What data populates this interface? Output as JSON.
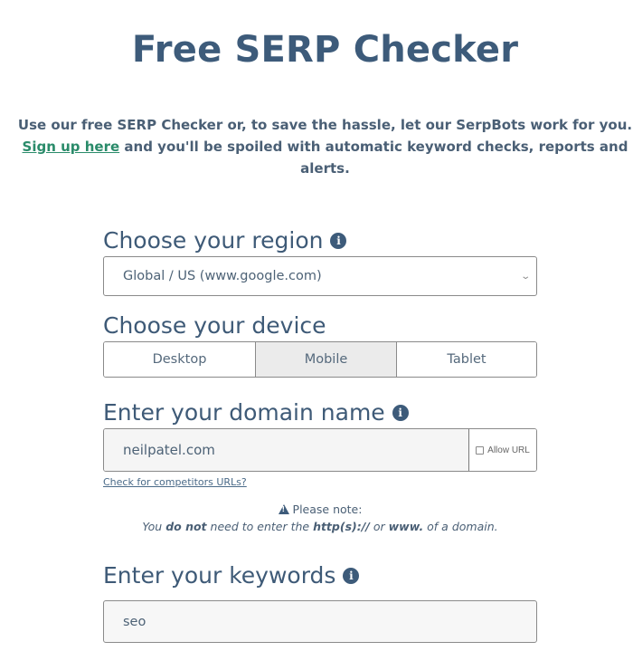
{
  "page": {
    "title": "Free SERP Checker",
    "intro_line1": "Use our free SERP Checker or, to save the hassle, let our SerpBots work for you.",
    "signup_link": "Sign up here",
    "intro_line2_rest": " and you'll be spoiled with automatic keyword checks, reports and alerts."
  },
  "region": {
    "label": "Choose your region",
    "info_icon": "i",
    "selected": "Global / US (www.google.com)",
    "chevron_icon": "⌄"
  },
  "device": {
    "label": "Choose your device",
    "options": [
      "Desktop",
      "Mobile",
      "Tablet"
    ],
    "selected": "Mobile"
  },
  "domain": {
    "label": "Enter your domain name",
    "info_icon": "i",
    "value": "neilpatel.com",
    "allow_url_label": "Allow URL",
    "allow_url_checked": false,
    "competitors_link": "Check for competitors URLs?"
  },
  "note": {
    "heading": "Please note:",
    "text_1": "You ",
    "text_bold_1": "do not",
    "text_2": " need to enter the ",
    "text_bold_2": "http(s)://",
    "text_3": " or ",
    "text_bold_3": "www.",
    "text_4": " of a domain."
  },
  "keywords": {
    "label": "Enter your keywords",
    "info_icon": "i",
    "value": "seo"
  },
  "colors": {
    "heading": "#3d5b7a",
    "link_green": "#2a8b6a",
    "selected_segment": "#ebebeb"
  }
}
